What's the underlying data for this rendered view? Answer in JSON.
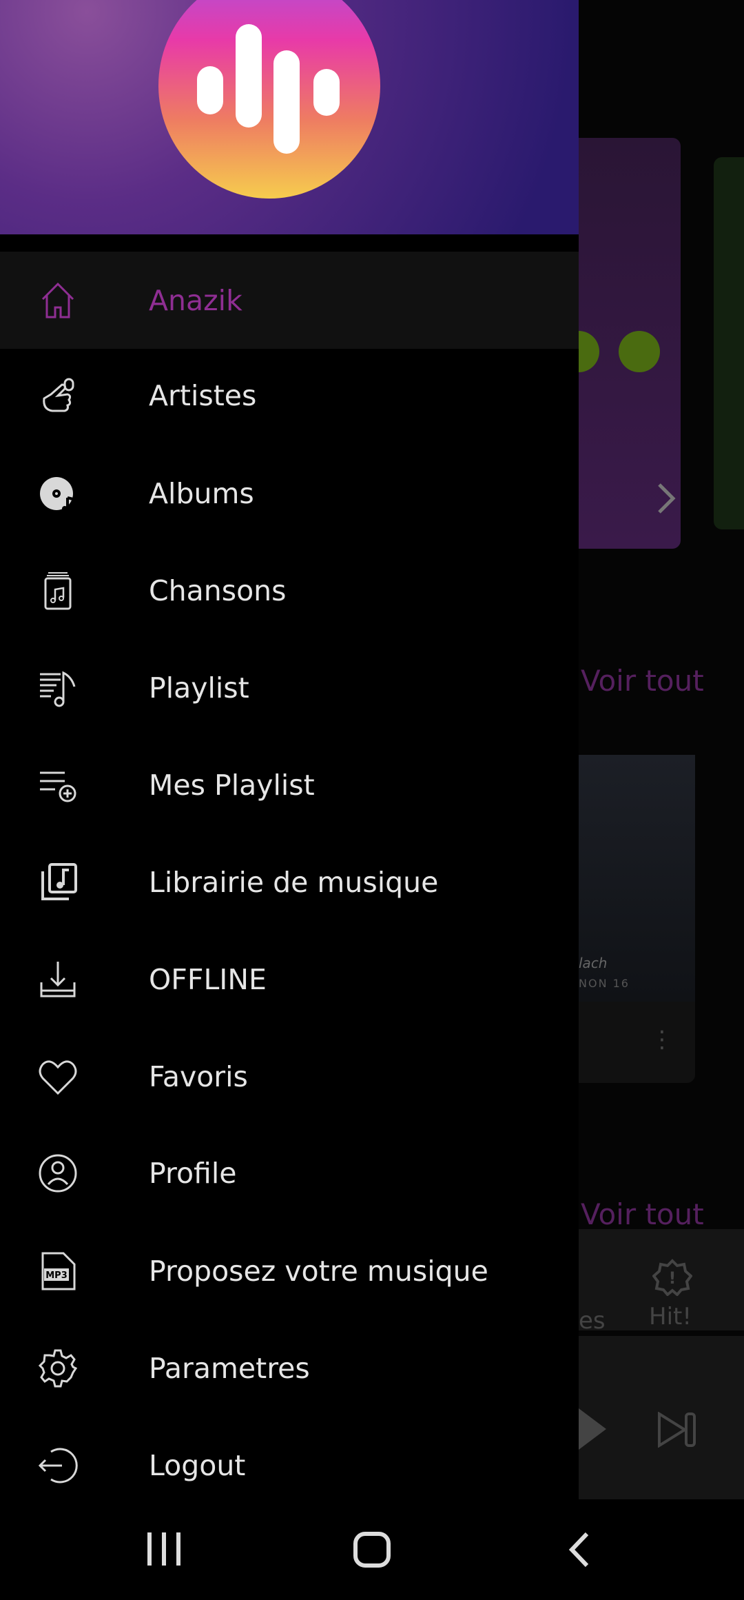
{
  "drawer": {
    "items": [
      {
        "label": "Anazik",
        "icon": "home-icon",
        "selected": true
      },
      {
        "label": "Artistes",
        "icon": "hand-mic-icon"
      },
      {
        "label": "Albums",
        "icon": "vinyl-icon"
      },
      {
        "label": "Chansons",
        "icon": "music-file-icon"
      },
      {
        "label": "Playlist",
        "icon": "playlist-icon"
      },
      {
        "label": "Mes Playlist",
        "icon": "playlist-add-icon"
      },
      {
        "label": "Librairie de musique",
        "icon": "music-library-icon"
      },
      {
        "label": "OFFLINE",
        "icon": "download-icon"
      },
      {
        "label": "Favoris",
        "icon": "heart-icon"
      },
      {
        "label": "Profile",
        "icon": "user-circle-icon"
      },
      {
        "label": "Proposez votre musique",
        "icon": "mp3-file-icon"
      },
      {
        "label": "Parametres",
        "icon": "gear-icon"
      },
      {
        "label": "Logout",
        "icon": "logout-icon"
      }
    ],
    "accent": "#8f2e93"
  },
  "background": {
    "voir_tout_1": "Voir tout",
    "voir_tout_2": "Voir tout",
    "album_caption_1": "lach",
    "album_caption_2": "NON 16",
    "tab_partial": "es",
    "tab_hit": "Hit!"
  }
}
